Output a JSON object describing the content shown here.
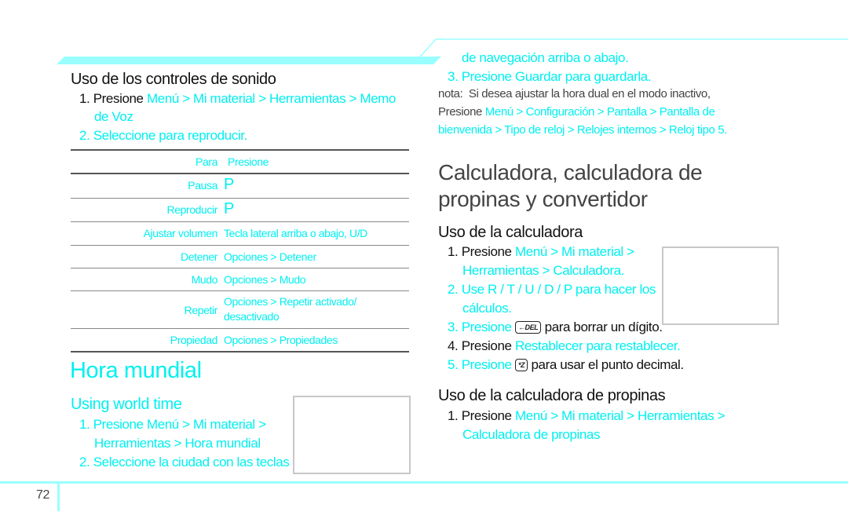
{
  "page_number": "72",
  "left": {
    "sound_controls": {
      "heading": "Uso de los controles de sonido",
      "step1": {
        "number": "1.",
        "prefix": "Presione",
        "path_line1": "Menú > Mi material > Herramientas > Memo",
        "path_line2": "de Voz"
      },
      "step2": {
        "number": "2.",
        "text": "Seleccione para reproducir."
      },
      "table": {
        "headers": [
          "Para",
          "Presione"
        ],
        "rows": [
          {
            "action": "Pausa",
            "press": "P"
          },
          {
            "action": "Reproducir",
            "press": "P"
          },
          {
            "action": "Ajustar volumen",
            "press": "Tecla lateral arriba o abajo, U/D"
          },
          {
            "action": "Detener",
            "press": "Opciones > Detener"
          },
          {
            "action": "Mudo",
            "press": "Opciones > Mudo"
          },
          {
            "action": "Repetir",
            "press": "Opciones > Repetir activado/",
            "press_line2": "desactivado"
          },
          {
            "action": "Propiedad",
            "press": "Opciones > Propiedades"
          }
        ]
      }
    },
    "world_time": {
      "title": "Hora mundial",
      "subheading": "Using world time",
      "step1": {
        "number": "1.",
        "line1": "Presione Menú > Mi material >",
        "line2": "Herramientas > Hora mundial"
      },
      "step2": {
        "number": "2.",
        "line1": "Seleccione la ciudad con las teclas"
      }
    }
  },
  "right": {
    "world_time_cont": {
      "step2_line2": "de navegación arriba o abajo.",
      "step3": "3. Presione Guardar para guardarla.",
      "note_label": "nota:",
      "note_text": "Si desea ajustar la hora dual en el modo inactivo,",
      "note_prefix": "Presione",
      "note_path_line1": "Menú > Configuración > Pantalla > Pantalla de",
      "note_path_line2": "bienvenida > Tipo de reloj > Relojes internos > Reloj tipo 5."
    },
    "calculator": {
      "title_line1": "Calculadora, calculadora de",
      "title_line2": "propinas y convertidor",
      "heading": "Uso de la calculadora",
      "step1_number": "1.",
      "step1_prefix": "Presione",
      "step1_path_line1": "Menú > Mi material >",
      "step1_path_line2": "Herramientas > Calculadora.",
      "step2_line1": "2. Use R / T / U / D / P      para hacer los",
      "step2_line2": "cálculos.",
      "step3_prefix": "3. Presione",
      "step3_key": "←DEL",
      "step3_suffix": "para borrar un dígito.",
      "step4_prefix": "4. Presione",
      "step4_highlight": "Restablecer para restablecer.",
      "step5_prefix": "5. Presione",
      "step5_key": "*Z",
      "step5_suffix": "para usar el punto decimal."
    },
    "tip_calculator": {
      "heading": "Uso de la calculadora de propinas",
      "step1_number": "1.",
      "step1_prefix": "Presione",
      "step1_path_line1": "Menú > Mi material > Herramientas >",
      "step1_path_line2": "Calculadora de propinas"
    }
  }
}
